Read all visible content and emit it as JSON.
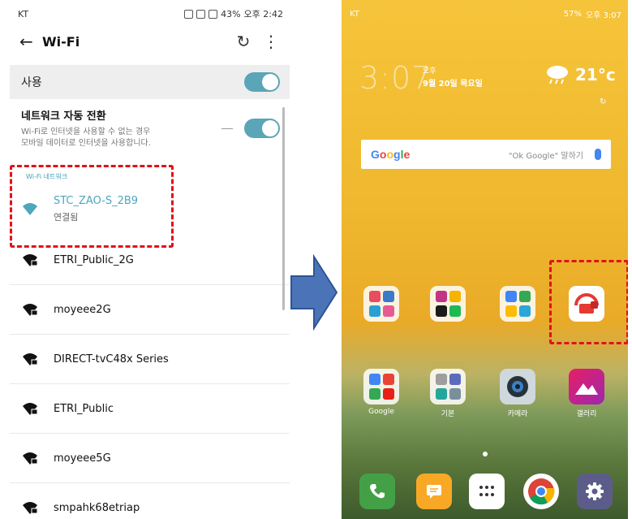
{
  "left_phone": {
    "status_bar": {
      "carrier": "KT",
      "battery": "43%",
      "time": "오후 2:42"
    },
    "header": {
      "title": "Wi-Fi"
    },
    "use_row": {
      "label": "사용",
      "enabled": true
    },
    "auto_switch": {
      "title": "네트워크 자동 전환",
      "description": "Wi-Fi로 인터넷을 사용할 수 없는 경우\n모바일 데이터로 인터넷을 사용합니다.",
      "enabled": true
    },
    "section_label": "Wi-Fi 네트워크",
    "networks": [
      {
        "name": "STC_ZAO-S_2B9",
        "status": "연결됨",
        "connected": true
      },
      {
        "name": "ETRI_Public_2G",
        "status": "",
        "connected": false
      },
      {
        "name": "moyeee2G",
        "status": "",
        "connected": false
      },
      {
        "name": "DIRECT-tvC48x Series",
        "status": "",
        "connected": false
      },
      {
        "name": "ETRI_Public",
        "status": "",
        "connected": false
      },
      {
        "name": "moyeee5G",
        "status": "",
        "connected": false
      },
      {
        "name": "smpahk68etriap",
        "status": "",
        "connected": false
      }
    ],
    "colors": {
      "accent": "#4fa6bd",
      "highlight": "#e0121b"
    }
  },
  "right_phone": {
    "status_bar": {
      "carrier": "KT",
      "battery": "57%",
      "time": "오후 3:07"
    },
    "clock": {
      "time": "3:07",
      "ampm": "오후",
      "date": "9월 20일 목요일"
    },
    "weather": {
      "temp": "21°c",
      "icon": "cloud-rain-icon"
    },
    "search": {
      "logo": "Google",
      "hint": "\"Ok Google\" 말하기"
    },
    "apps_row1": [
      {
        "label": "",
        "icon": "folder-icon"
      },
      {
        "label": "",
        "icon": "folder-icon"
      },
      {
        "label": "",
        "icon": "folder-icon"
      },
      {
        "label": "",
        "icon": "highlighted-app-icon"
      }
    ],
    "apps_row2": [
      {
        "label": "Google",
        "icon": "google-folder-icon"
      },
      {
        "label": "기본",
        "icon": "tools-folder-icon"
      },
      {
        "label": "카메라",
        "icon": "camera-icon"
      },
      {
        "label": "갤러리",
        "icon": "gallery-icon"
      }
    ],
    "dock": [
      "phone-icon",
      "messages-icon",
      "apps-grid-icon",
      "chrome-icon",
      "settings-icon"
    ],
    "colors": {
      "wallpaper_top": "#f6c43a",
      "highlight": "#e0121b"
    }
  }
}
